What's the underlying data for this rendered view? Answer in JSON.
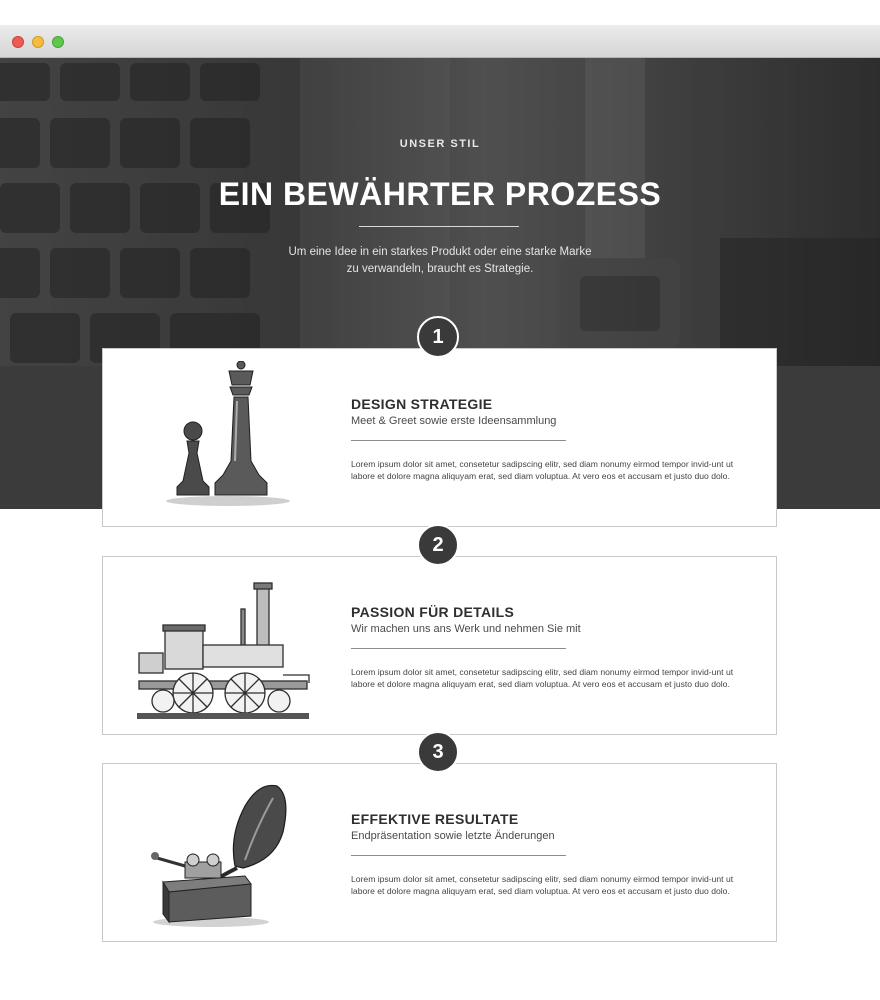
{
  "window": {
    "controls": [
      "close",
      "minimize",
      "maximize"
    ],
    "control_colors": [
      "#ee5b52",
      "#f4bd3c",
      "#5fc84c"
    ]
  },
  "hero": {
    "eyebrow": "UNSER STIL",
    "title": "EIN BEWÄHRTER PROZESS",
    "subtitle_line1": "Um eine Idee in ein starkes Produkt oder eine starke Marke",
    "subtitle_line2": "zu verwandeln, braucht es Strategie."
  },
  "colors": {
    "dark": "#3b3b3b",
    "card_border": "#c9c9c9",
    "text": "#333333"
  },
  "steps": [
    {
      "number": "1",
      "icon": "chess-pieces-illustration",
      "title": "DESIGN STRATEGIE",
      "subtitle": "Meet & Greet sowie erste Ideensammlung",
      "body": "Lorem ipsum dolor sit amet, consetetur sadipscing elitr, sed diam nonumy eirmod tempor invid-unt ut labore et dolore magna aliquyam erat, sed diam voluptua. At vero eos et accusam et justo duo dolo."
    },
    {
      "number": "2",
      "icon": "locomotive-illustration",
      "title": "PASSION FÜR DETAILS",
      "subtitle": "Wir machen uns ans Werk und nehmen Sie mit",
      "body": "Lorem ipsum dolor sit amet, consetetur sadipscing elitr, sed diam nonumy eirmod tempor invid-unt ut labore et dolore magna aliquyam erat, sed diam voluptua. At vero eos et accusam et justo duo dolo."
    },
    {
      "number": "3",
      "icon": "gramophone-illustration",
      "title": "EFFEKTIVE RESULTATE",
      "subtitle": "Endpräsentation sowie letzte Änderungen",
      "body": "Lorem ipsum dolor sit amet, consetetur sadipscing elitr, sed diam nonumy eirmod tempor invid-unt ut labore et dolore magna aliquyam erat, sed diam voluptua. At vero eos et accusam et justo duo dolo."
    }
  ]
}
